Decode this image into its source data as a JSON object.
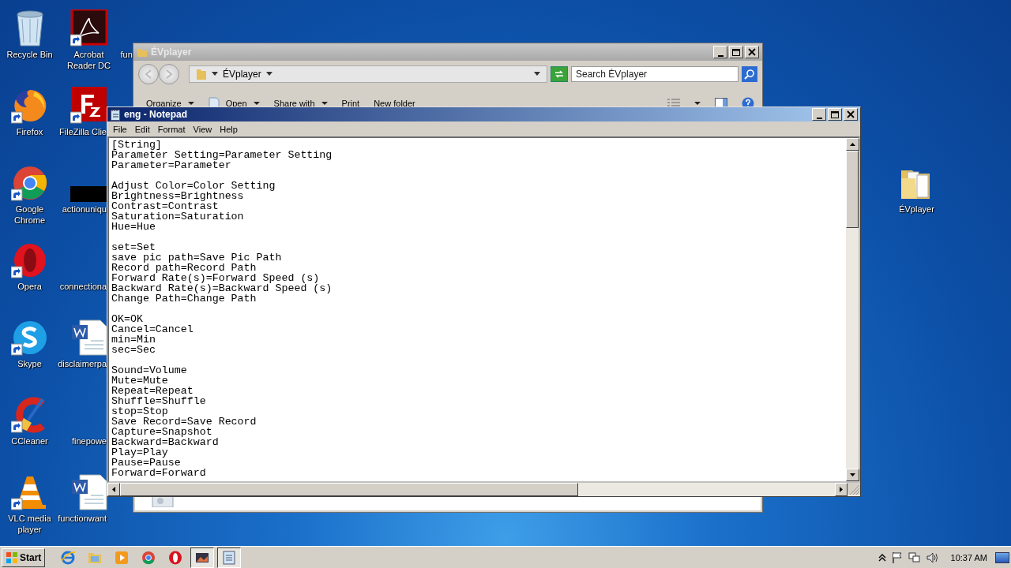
{
  "desktop": {
    "icons": [
      {
        "label": "Recycle Bin",
        "kind": "recycle",
        "shortcut": false
      },
      {
        "label": "Acrobat Reader DC",
        "kind": "pdf",
        "shortcut": true
      },
      {
        "label": "fun",
        "kind": "hidden"
      },
      {
        "label": "Firefox",
        "kind": "firefox",
        "shortcut": true
      },
      {
        "label": "FileZilla Clie",
        "kind": "filezilla",
        "shortcut": true
      },
      {
        "label": "Google Chrome",
        "kind": "chrome",
        "shortcut": true
      },
      {
        "label": "actionuniqu",
        "kind": "blackbox"
      },
      {
        "label": "Opera",
        "kind": "opera",
        "shortcut": true
      },
      {
        "label": "connectiona",
        "kind": "blank"
      },
      {
        "label": "Skype",
        "kind": "skype",
        "shortcut": true
      },
      {
        "label": "disclaimerpa",
        "kind": "word",
        "shortcut": false
      },
      {
        "label": "CCleaner",
        "kind": "ccleaner",
        "shortcut": true
      },
      {
        "label": "finepowe",
        "kind": "blank"
      },
      {
        "label": "VLC media player",
        "kind": "vlc",
        "shortcut": true
      },
      {
        "label": "functionwant",
        "kind": "word",
        "shortcut": false
      },
      {
        "label": "ÉVplayer",
        "kind": "folder",
        "shortcut": false
      }
    ]
  },
  "explorer": {
    "title": "ÉVplayer",
    "address": "ÉVplayer",
    "search_placeholder": "Search ÉVplayer",
    "toolbar": [
      {
        "label": "Organize",
        "kind": "menu"
      },
      {
        "label": "Open",
        "kind": "open"
      },
      {
        "label": "Share with",
        "kind": "menu"
      },
      {
        "label": "Print",
        "kind": "plain"
      },
      {
        "label": "New folder",
        "kind": "plain"
      }
    ]
  },
  "notepad": {
    "title": "eng - Notepad",
    "menu": [
      "File",
      "Edit",
      "Format",
      "View",
      "Help"
    ],
    "paragraphs": [
      [
        "[String]",
        "Parameter Setting=Parameter Setting",
        "Parameter=Parameter"
      ],
      [
        "Adjust Color=Color Setting",
        "Brightness=Brightness",
        "Contrast=Contrast",
        "Saturation=Saturation",
        "Hue=Hue"
      ],
      [
        "set=Set",
        "save pic path=Save Pic Path",
        "Record path=Record Path",
        "Forward Rate(s)=Forward Speed (s)",
        "Backward Rate(s)=Backward Speed (s)",
        "Change Path=Change Path"
      ],
      [
        "OK=OK",
        "Cancel=Cancel",
        "min=Min",
        "sec=Sec"
      ],
      [
        "Sound=Volume",
        "Mute=Mute",
        "Repeat=Repeat",
        "Shuffle=Shuffle",
        "stop=Stop",
        "Save Record=Save Record",
        "Capture=Snapshot",
        "Backward=Backward",
        "Play=Play",
        "Pause=Pause",
        "Forward=Forward"
      ]
    ]
  },
  "taskbar": {
    "start": "Start",
    "apps": [
      {
        "kind": "ie",
        "selected": false
      },
      {
        "kind": "folder",
        "selected": false
      },
      {
        "kind": "media",
        "selected": false
      },
      {
        "kind": "chrome",
        "selected": false
      },
      {
        "kind": "opera",
        "selected": false
      },
      {
        "kind": "picture",
        "selected": true
      },
      {
        "kind": "notepad",
        "selected": true
      }
    ],
    "time": "10:37 AM"
  }
}
